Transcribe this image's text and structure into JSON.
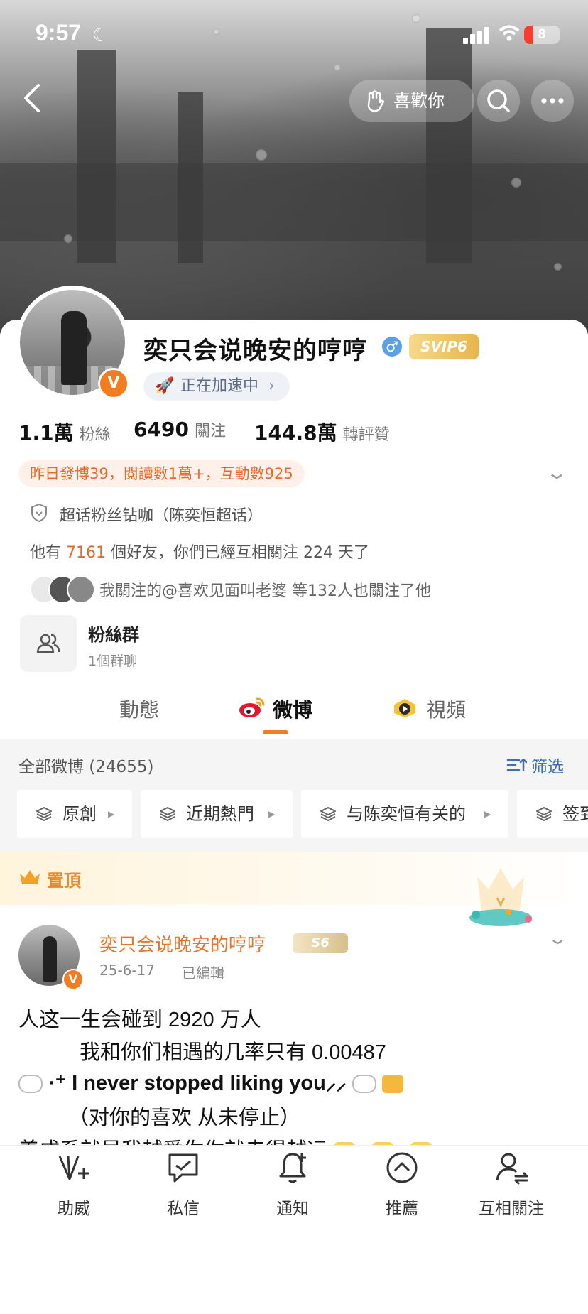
{
  "status_bar": {
    "time": "9:57",
    "battery": "8"
  },
  "header": {
    "like_label": "喜歡你"
  },
  "profile": {
    "name": "奕只会说晚安的哼哼",
    "verified_mark": "V",
    "svip_label": "SVIP6",
    "boost_label": "正在加速中",
    "stats": [
      {
        "value": "1.1萬",
        "label": "粉絲"
      },
      {
        "value": "6490",
        "label": "關注"
      },
      {
        "value": "144.8萬",
        "label": "轉評贊"
      }
    ],
    "activity": "昨日發博39，閱讀數1萬+，互動數925",
    "super_topic": "超话粉丝钻咖（陈奕恒超话）",
    "friends": {
      "prefix": "他有",
      "count": "7161",
      "suffix": "個好友，你們已經互相關注 224 天了"
    },
    "mutual_follow": "我關注的@喜欢见面叫老婆 等132人也關注了他",
    "fan_group": {
      "title": "粉絲群",
      "subtitle": "1個群聊"
    }
  },
  "tabs": [
    "動態",
    "微博",
    "視頻"
  ],
  "feed": {
    "count_label": "全部微博 (24655)",
    "filter_label": "筛选",
    "chips": [
      "原創",
      "近期熱門",
      "与陈奕恒有关的",
      "签到"
    ]
  },
  "pinned": {
    "label": "置頂",
    "author": "奕只会说晚安的哼哼",
    "level": "S6",
    "date": "25-6-17",
    "edited": "已編輯",
    "lines": [
      "人这一生会碰到 2920 万人",
      "我和你们相遇的几率只有 0.00487",
      "·⁺ I never stopped liking you⸝⸝",
      "（对你的喜欢 从未停止）",
      "养成系就是我越爱你你就走得越远"
    ]
  },
  "bottom_nav": [
    "助威",
    "私信",
    "通知",
    "推薦",
    "互相關注"
  ],
  "colors": {
    "accent": "#f47c1f",
    "link": "#3d6fb8",
    "pinned": "#e8892c"
  }
}
